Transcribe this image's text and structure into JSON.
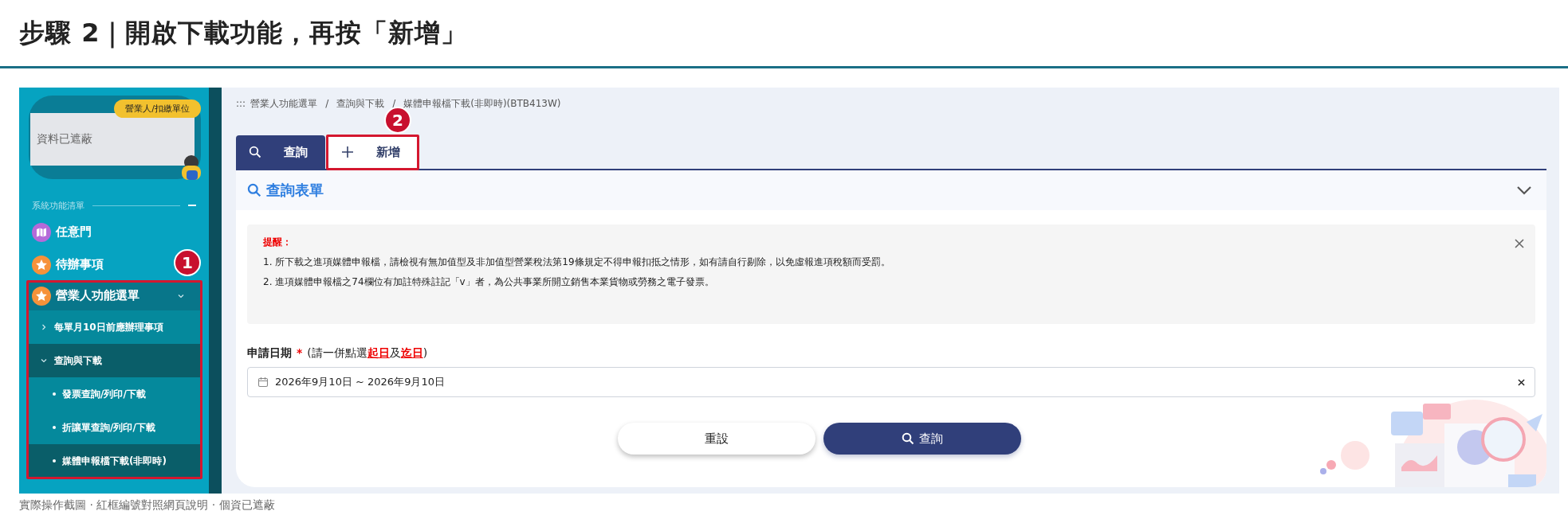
{
  "header": {
    "title": "步驟 2｜開啟下載功能，再按「新增」"
  },
  "sidebar": {
    "badge": "營業人/扣繳單位",
    "masked_text": "資料已遮蔽",
    "section_title": "系統功能清單",
    "items": [
      {
        "kind": "map",
        "label": "任意門"
      },
      {
        "kind": "star",
        "label": "待辦事項"
      },
      {
        "kind": "star",
        "label": "營業人功能選單",
        "expanded": true,
        "annotation": "1",
        "children": [
          {
            "label": "每單月10日前應辦理事項",
            "expanded": false
          },
          {
            "label": "查詢與下載",
            "expanded": true,
            "children": [
              {
                "label": "發票查詢/列印/下載",
                "selected": false
              },
              {
                "label": "折讓單查詢/列印/下載",
                "selected": false
              },
              {
                "label": "媒體申報檔下載(非即時)",
                "selected": true
              }
            ]
          }
        ]
      }
    ]
  },
  "breadcrumb": {
    "prefix": ":::",
    "separator": "/",
    "items": [
      "營業人功能選單",
      "查詢與下載",
      "媒體申報檔下載(非即時)(BTB413W)"
    ]
  },
  "tabs": [
    {
      "kind": "search",
      "label": "查詢",
      "selected": true
    },
    {
      "kind": "add",
      "label": "新增",
      "selected": false,
      "annotation": "2"
    }
  ],
  "panel": {
    "title": "查詢表單",
    "expanded": true
  },
  "notice": {
    "title": "提醒：",
    "lines": [
      "1. 所下載之進項媒體申報檔，請檢視有無加值型及非加值型營業稅法第19條規定不得申報扣抵之情形，如有請自行剔除，以免虛報進項稅額而受罰。",
      "2. 進項媒體申報檔之74欄位有加註特殊註記「v」者，為公共事業所開立銷售本業貨物或勞務之電子發票。"
    ]
  },
  "form": {
    "label": "申請日期",
    "required": "*",
    "hint": "(請一併點選**起日**及**迄日**)",
    "date_value": "2026年9月10日 ~ 2026年9月10日"
  },
  "buttons": [
    {
      "kind": "reset",
      "label": "重設"
    },
    {
      "kind": "search",
      "label": "查詢"
    }
  ],
  "caption": "實際操作截圖 · 紅框編號對照網頁說明 · 個資已遮蔽"
}
